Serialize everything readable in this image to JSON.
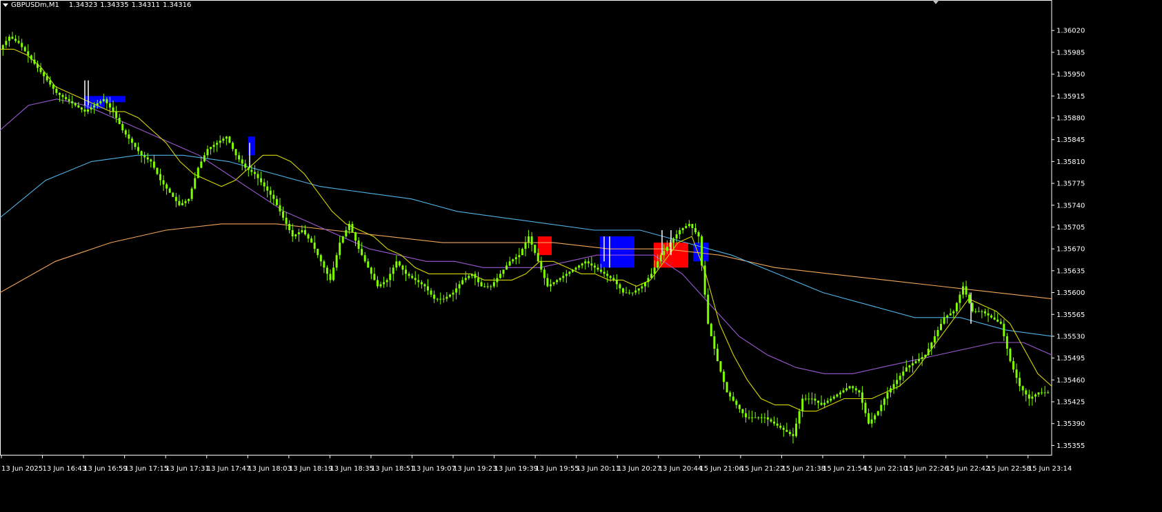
{
  "header": {
    "symbol": "GBPUSDm,M1",
    "ohlc": [
      "1.34323",
      "1.34335",
      "1.34311",
      "1.34316"
    ]
  },
  "colors": {
    "background": "#000000",
    "axis": "#ffffff",
    "candle": "#7fff00",
    "candle_white": "#ffffff",
    "ma_fast": "#d8d800",
    "ma_mid": "#9acd32",
    "ma_slow_violet": "#9b59d0",
    "ma_slow_blue": "#4fb3e8",
    "ma_long_orange": "#f2a65a",
    "fill_down": "#0000ff",
    "fill_up": "#ff0000"
  },
  "chart_data": {
    "type": "line",
    "title": "GBPUSDm,M1",
    "ylim": [
      1.3534,
      1.3606
    ],
    "y_ticks": [
      "1.36020",
      "1.35985",
      "1.35950",
      "1.35915",
      "1.35880",
      "1.35845",
      "1.35810",
      "1.35775",
      "1.35740",
      "1.35705",
      "1.35670",
      "1.35635",
      "1.35600",
      "1.35565",
      "1.35530",
      "1.35495",
      "1.35460",
      "1.35425",
      "1.35390",
      "1.35355"
    ],
    "x_ticks": [
      "13 Jun 2025",
      "13 Jun 16:43",
      "13 Jun 16:59",
      "13 Jun 17:15",
      "13 Jun 17:31",
      "13 Jun 17:47",
      "13 Jun 18:03",
      "13 Jun 18:19",
      "13 Jun 18:35",
      "13 Jun 18:51",
      "13 Jun 19:07",
      "13 Jun 19:23",
      "13 Jun 19:39",
      "13 Jun 19:55",
      "13 Jun 20:11",
      "13 Jun 20:27",
      "13 Jun 20:44",
      "15 Jun 21:06",
      "15 Jun 21:22",
      "15 Jun 21:38",
      "15 Jun 21:54",
      "15 Jun 22:10",
      "15 Jun 22:26",
      "15 Jun 22:42",
      "15 Jun 22:58",
      "15 Jun 23:14"
    ],
    "series": [
      {
        "color": "#7fff00",
        "values": [
          1.3599,
          1.3601,
          1.36,
          1.3598,
          1.3596,
          1.3594,
          1.3592,
          1.3591,
          1.359,
          1.3589,
          1.359,
          1.3591,
          1.3589,
          1.3586,
          1.3584,
          1.3582,
          1.3581,
          1.3578,
          1.3576,
          1.3574,
          1.3575,
          1.358,
          1.3583,
          1.3584,
          1.3585,
          1.3582,
          1.358,
          1.3579,
          1.3577,
          1.3575,
          1.3572,
          1.3569,
          1.357,
          1.3568,
          1.3565,
          1.3562,
          1.3568,
          1.3571,
          1.3567,
          1.3564,
          1.3561,
          1.3562,
          1.3565,
          1.3563,
          1.3562,
          1.3561,
          1.3559,
          1.3559,
          1.356,
          1.3562,
          1.3563,
          1.3561,
          1.3561,
          1.3563,
          1.3565,
          1.3566,
          1.3569,
          1.3565,
          1.3561,
          1.3562,
          1.3563,
          1.3564,
          1.3565,
          1.3564,
          1.3563,
          1.3562,
          1.356,
          1.356,
          1.3561,
          1.3563,
          1.3566,
          1.3568,
          1.357,
          1.3571,
          1.3569,
          1.3555,
          1.3549,
          1.3544,
          1.3542,
          1.354,
          1.354,
          1.354,
          1.3539,
          1.3538,
          1.3537,
          1.3543,
          1.3543,
          1.3542,
          1.3543,
          1.3544,
          1.3545,
          1.3544,
          1.3539,
          1.3541,
          1.3544,
          1.3546,
          1.3548,
          1.3549,
          1.355,
          1.3553,
          1.3556,
          1.3557,
          1.3561,
          1.3557,
          1.3557,
          1.3556,
          1.3555,
          1.3549,
          1.3545,
          1.3543,
          1.3544,
          1.3544
        ]
      },
      {
        "color": "#d8d800",
        "values": [
          1.3599,
          1.3599,
          1.3598,
          1.3596,
          1.3593,
          1.3592,
          1.3591,
          1.359,
          1.3589,
          1.3589,
          1.3588,
          1.3586,
          1.3584,
          1.3581,
          1.3579,
          1.3578,
          1.3577,
          1.3578,
          1.358,
          1.3582,
          1.3582,
          1.3581,
          1.3579,
          1.3576,
          1.3573,
          1.3571,
          1.357,
          1.3569,
          1.3567,
          1.3566,
          1.3564,
          1.3563,
          1.3563,
          1.3563,
          1.3563,
          1.3562,
          1.3562,
          1.3562,
          1.3563,
          1.3565,
          1.3565,
          1.3564,
          1.3563,
          1.3563,
          1.3562,
          1.3562,
          1.3561,
          1.3562,
          1.3565,
          1.3568,
          1.3569,
          1.3563,
          1.3555,
          1.355,
          1.3546,
          1.3543,
          1.3542,
          1.3542,
          1.3541,
          1.3541,
          1.3542,
          1.3543,
          1.3543,
          1.3543,
          1.3544,
          1.3545,
          1.3547,
          1.355,
          1.3553,
          1.3556,
          1.3559,
          1.3558,
          1.3557,
          1.3555,
          1.3551,
          1.3547,
          1.3545
        ]
      },
      {
        "color": "#9b59d0",
        "values": [
          1.3586,
          1.359,
          1.3591,
          1.359,
          1.3588,
          1.3586,
          1.3584,
          1.3582,
          1.3579,
          1.3576,
          1.3573,
          1.3571,
          1.3569,
          1.3567,
          1.3566,
          1.3565,
          1.3565,
          1.3564,
          1.3564,
          1.3564,
          1.3565,
          1.3566,
          1.3566,
          1.3566,
          1.3563,
          1.3558,
          1.3553,
          1.355,
          1.3548,
          1.3547,
          1.3547,
          1.3548,
          1.3549,
          1.355,
          1.3551,
          1.3552,
          1.3552,
          1.355
        ]
      },
      {
        "color": "#4fb3e8",
        "values": [
          1.3572,
          1.3578,
          1.3581,
          1.3582,
          1.3582,
          1.3581,
          1.3579,
          1.3577,
          1.3576,
          1.3575,
          1.3573,
          1.3572,
          1.3571,
          1.357,
          1.357,
          1.3568,
          1.3566,
          1.3563,
          1.356,
          1.3558,
          1.3556,
          1.3556,
          1.3554,
          1.3553
        ]
      },
      {
        "color": "#f2a65a",
        "values": [
          1.356,
          1.3565,
          1.3568,
          1.357,
          1.3571,
          1.3571,
          1.357,
          1.3569,
          1.3568,
          1.3568,
          1.3568,
          1.3567,
          1.3567,
          1.3566,
          1.3564,
          1.3563,
          1.3562,
          1.3561,
          1.356,
          1.3559
        ]
      }
    ]
  }
}
